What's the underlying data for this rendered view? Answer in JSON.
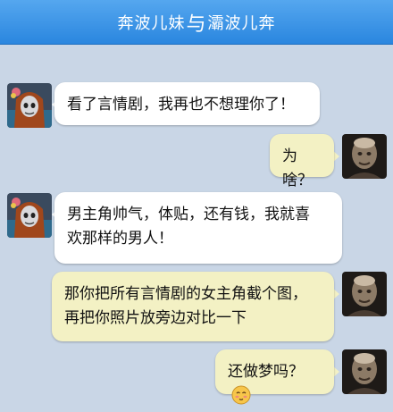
{
  "header": {
    "title_left": "奔波儿妹",
    "title_connector": "与",
    "title_right": "灞波儿奔"
  },
  "messages": [
    {
      "side": "left",
      "sender": "奔波儿妹",
      "text": "看了言情剧，我再也不想理你了！"
    },
    {
      "side": "right",
      "sender": "灞波儿奔",
      "text": "为啥？"
    },
    {
      "side": "left",
      "sender": "奔波儿妹",
      "line1": "男主角帅气，体贴，还有钱，我就喜",
      "line2": "欢那样的男人！"
    },
    {
      "side": "right",
      "sender": "灞波儿奔",
      "line1": "那你把所有言情剧的女主角截个图，",
      "line2": "再把你照片放旁边对比一下"
    },
    {
      "side": "right",
      "sender": "灞波儿奔",
      "text": "还做梦吗？",
      "emoji": "shy-face-emoji"
    }
  ],
  "colors": {
    "titlebar": "#3b95e8",
    "chat_background": "#c9d6e6",
    "left_bubble": "#ffffff",
    "right_bubble": "#f3f1c4"
  }
}
